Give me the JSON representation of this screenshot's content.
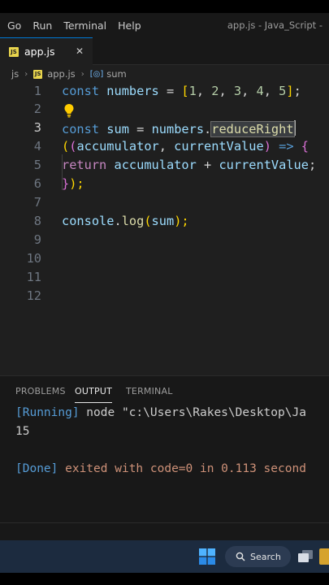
{
  "menubar": {
    "items": [
      "Go",
      "Run",
      "Terminal",
      "Help"
    ],
    "window_title": "app.js - Java_Script -"
  },
  "tab": {
    "name": "app.js",
    "icon": "js-file-icon",
    "close": "✕",
    "accent": "#0078d4"
  },
  "breadcrumb": {
    "folder": "js",
    "file": "app.js",
    "symbol": "sum",
    "separator": "›"
  },
  "editor": {
    "line_numbers": [
      "1",
      "2",
      "3",
      "4",
      "5",
      "6",
      "7",
      "8",
      "9",
      "10",
      "11",
      "12"
    ],
    "active_line": 3,
    "tokens": {
      "const": "const",
      "numbers": "numbers",
      "assign": " = ",
      "arr_open": "[",
      "n1": "1",
      "n2": "2",
      "n3": "3",
      "n4": "4",
      "n5": "5",
      "comma": ", ",
      "arr_close": "]",
      "semi": ";",
      "sum": "sum",
      "dot": ".",
      "reduceRight": "reduceRight",
      "paren_open": "(",
      "paren_open2": "(",
      "accumulator": "accumulator",
      "currentValue": "currentValue",
      "paren_close": ")",
      "arrow": " => ",
      "brace_open": "{",
      "return": "return",
      "plus": " + ",
      "brace_close": "}",
      "close_tail": ");",
      "console": "console",
      "log": "log"
    }
  },
  "panel": {
    "tabs": [
      "PROBLEMS",
      "OUTPUT",
      "TERMINAL"
    ],
    "active_tab": "OUTPUT",
    "output": {
      "running_tag": "[Running]",
      "running_cmd": " node \"c:\\Users\\Rakes\\Desktop\\Ja",
      "result": "15",
      "done_tag": "[Done]",
      "done_msg": " exited with code=0 in 0.113 second"
    }
  },
  "taskbar": {
    "search_label": "Search",
    "accent": "#1c2b3f"
  }
}
